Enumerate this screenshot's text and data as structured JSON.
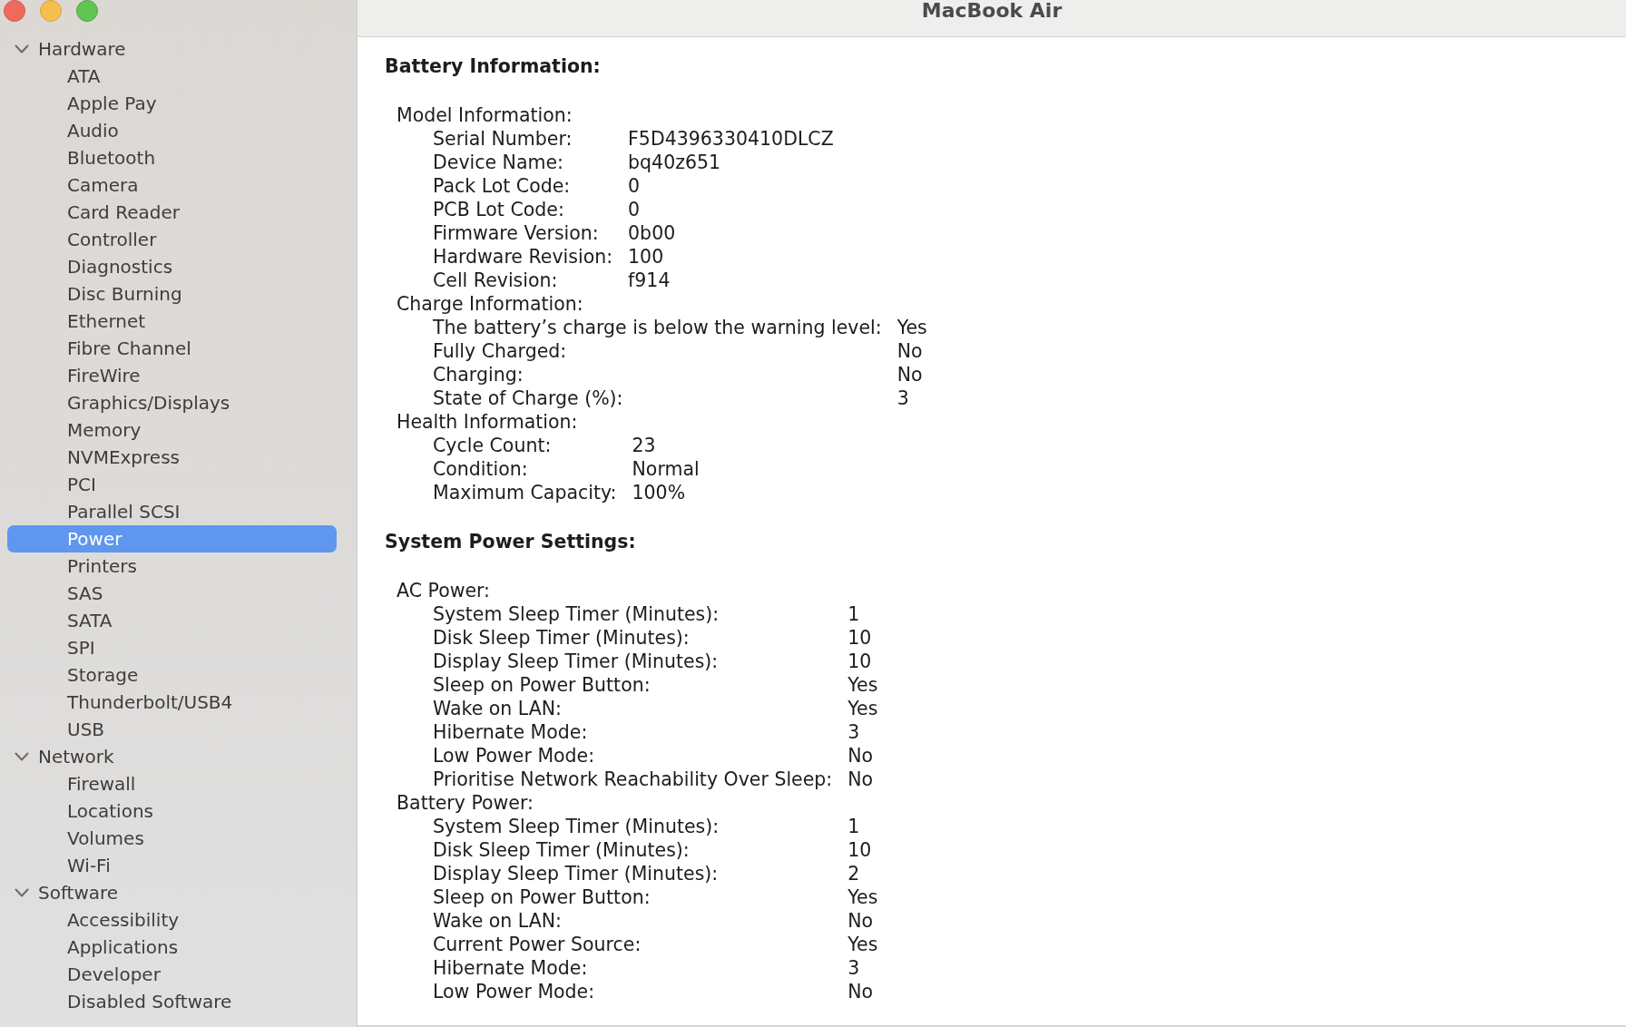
{
  "window": {
    "title": "MacBook Air"
  },
  "sidebar": {
    "items": [
      {
        "label": "Hardware",
        "expanded": true,
        "selected": false,
        "children": [
          {
            "label": "ATA",
            "selected": false
          },
          {
            "label": "Apple Pay",
            "selected": false
          },
          {
            "label": "Audio",
            "selected": false
          },
          {
            "label": "Bluetooth",
            "selected": false
          },
          {
            "label": "Camera",
            "selected": false
          },
          {
            "label": "Card Reader",
            "selected": false
          },
          {
            "label": "Controller",
            "selected": false
          },
          {
            "label": "Diagnostics",
            "selected": false
          },
          {
            "label": "Disc Burning",
            "selected": false
          },
          {
            "label": "Ethernet",
            "selected": false
          },
          {
            "label": "Fibre Channel",
            "selected": false
          },
          {
            "label": "FireWire",
            "selected": false
          },
          {
            "label": "Graphics/Displays",
            "selected": false
          },
          {
            "label": "Memory",
            "selected": false
          },
          {
            "label": "NVMExpress",
            "selected": false
          },
          {
            "label": "PCI",
            "selected": false
          },
          {
            "label": "Parallel SCSI",
            "selected": false
          },
          {
            "label": "Power",
            "selected": true
          },
          {
            "label": "Printers",
            "selected": false
          },
          {
            "label": "SAS",
            "selected": false
          },
          {
            "label": "SATA",
            "selected": false
          },
          {
            "label": "SPI",
            "selected": false
          },
          {
            "label": "Storage",
            "selected": false
          },
          {
            "label": "Thunderbolt/USB4",
            "selected": false
          },
          {
            "label": "USB",
            "selected": false
          }
        ]
      },
      {
        "label": "Network",
        "expanded": true,
        "selected": false,
        "children": [
          {
            "label": "Firewall",
            "selected": false
          },
          {
            "label": "Locations",
            "selected": false
          },
          {
            "label": "Volumes",
            "selected": false
          },
          {
            "label": "Wi-Fi",
            "selected": false
          }
        ]
      },
      {
        "label": "Software",
        "expanded": true,
        "selected": false,
        "children": [
          {
            "label": "Accessibility",
            "selected": false
          },
          {
            "label": "Applications",
            "selected": false
          },
          {
            "label": "Developer",
            "selected": false
          },
          {
            "label": "Disabled Software",
            "selected": false
          }
        ]
      }
    ]
  },
  "report": {
    "sections": [
      {
        "title": "Battery Information:",
        "kind": "columns-per-group",
        "groups": [
          {
            "title": "Model Information:",
            "rows": [
              {
                "label": "Serial Number:",
                "value": "F5D4396330410DLCZ"
              },
              {
                "label": "Device Name:",
                "value": "bq40z651"
              },
              {
                "label": "Pack Lot Code:",
                "value": "0"
              },
              {
                "label": "PCB Lot Code:",
                "value": "0"
              },
              {
                "label": "Firmware Version:",
                "value": "0b00"
              },
              {
                "label": "Hardware Revision:",
                "value": "100"
              },
              {
                "label": "Cell Revision:",
                "value": "f914"
              }
            ]
          },
          {
            "title": "Charge Information:",
            "rows": [
              {
                "label": "The battery’s charge is below the warning level:",
                "value": "Yes"
              },
              {
                "label": "Fully Charged:",
                "value": "No"
              },
              {
                "label": "Charging:",
                "value": "No"
              },
              {
                "label": "State of Charge (%):",
                "value": "3"
              }
            ]
          },
          {
            "title": "Health Information:",
            "rows": [
              {
                "label": "Cycle Count:",
                "value": "23"
              },
              {
                "label": "Condition:",
                "value": "Normal"
              },
              {
                "label": "Maximum Capacity:",
                "value": "100%"
              }
            ]
          }
        ]
      },
      {
        "title": "System Power Settings:",
        "kind": "shared-columns",
        "groups": [
          {
            "title": "AC Power:",
            "rows": [
              {
                "label": "System Sleep Timer (Minutes):",
                "value": "1"
              },
              {
                "label": "Disk Sleep Timer (Minutes):",
                "value": "10"
              },
              {
                "label": "Display Sleep Timer (Minutes):",
                "value": "10"
              },
              {
                "label": "Sleep on Power Button:",
                "value": "Yes"
              },
              {
                "label": "Wake on LAN:",
                "value": "Yes"
              },
              {
                "label": "Hibernate Mode:",
                "value": "3"
              },
              {
                "label": "Low Power Mode:",
                "value": "No"
              },
              {
                "label": "Prioritise Network Reachability Over Sleep:",
                "value": "No"
              }
            ]
          },
          {
            "title": "Battery Power:",
            "rows": [
              {
                "label": "System Sleep Timer (Minutes):",
                "value": "1"
              },
              {
                "label": "Disk Sleep Timer (Minutes):",
                "value": "10"
              },
              {
                "label": "Display Sleep Timer (Minutes):",
                "value": "2"
              },
              {
                "label": "Sleep on Power Button:",
                "value": "Yes"
              },
              {
                "label": "Wake on LAN:",
                "value": "No"
              },
              {
                "label": "Current Power Source:",
                "value": "Yes"
              },
              {
                "label": "Hibernate Mode:",
                "value": "3"
              },
              {
                "label": "Low Power Mode:",
                "value": "No"
              }
            ]
          }
        ]
      }
    ]
  }
}
